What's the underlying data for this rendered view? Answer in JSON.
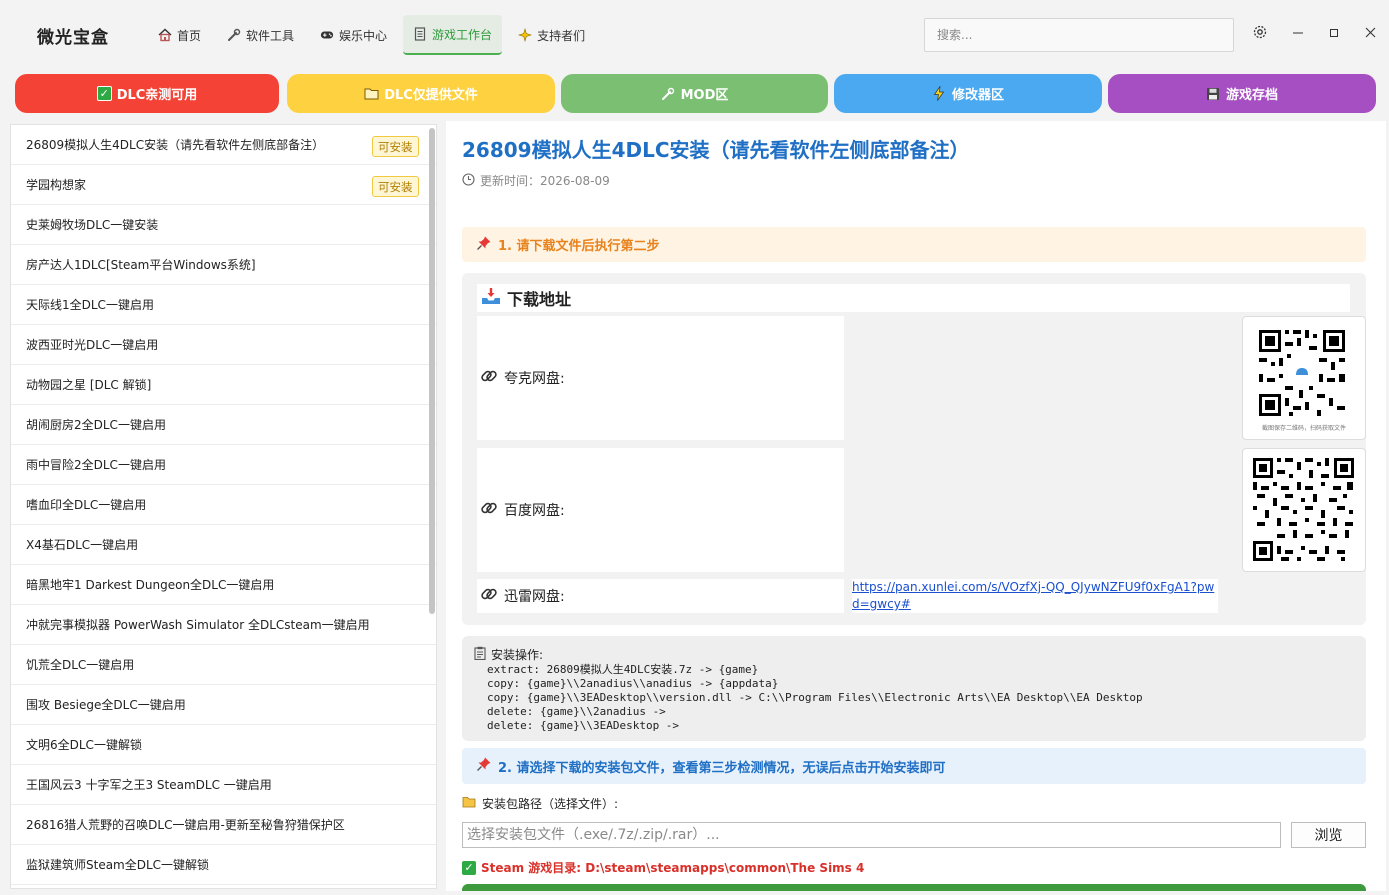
{
  "app": {
    "title": "微光宝盒"
  },
  "nav": [
    {
      "label": "首页",
      "icon": "home-icon"
    },
    {
      "label": "软件工具",
      "icon": "wrench-icon"
    },
    {
      "label": "娱乐中心",
      "icon": "gamepad-icon"
    },
    {
      "label": "游戏工作台",
      "icon": "document-icon",
      "active": true
    },
    {
      "label": "支持者们",
      "icon": "sparkle-icon"
    }
  ],
  "search": {
    "placeholder": "搜索..."
  },
  "window_controls": {
    "settings": "gear-icon",
    "minimize": "minimize-icon",
    "maximize": "maximize-icon",
    "close": "close-icon"
  },
  "categories": [
    {
      "label": "DLC亲测可用",
      "color": "#f44336",
      "icon": "check-box-icon"
    },
    {
      "label": "DLC仅提供文件",
      "color": "#fdd13f",
      "icon": "folder-icon"
    },
    {
      "label": "MOD区",
      "color": "#7bbf72",
      "icon": "wrench-icon"
    },
    {
      "label": "修改器区",
      "color": "#4aa9f0",
      "icon": "lightning-icon"
    },
    {
      "label": "游戏存档",
      "color": "#a64fc2",
      "icon": "floppy-icon"
    }
  ],
  "list": [
    {
      "name": "26809模拟人生4DLC安装（请先看软件左侧底部备注）",
      "badge": "可安装"
    },
    {
      "name": "学园构想家",
      "badge": "可安装"
    },
    {
      "name": "史莱姆牧场DLC一键安装"
    },
    {
      "name": "房产达人1DLC[Steam平台Windows系统]"
    },
    {
      "name": "天际线1全DLC一键启用"
    },
    {
      "name": "波西亚时光DLC一键启用"
    },
    {
      "name": "动物园之星 [DLC 解锁]"
    },
    {
      "name": "胡闹厨房2全DLC一键启用"
    },
    {
      "name": "雨中冒险2全DLC一键启用"
    },
    {
      "name": "嗜血印全DLC一键启用"
    },
    {
      "name": "X4基石DLC一键启用"
    },
    {
      "name": "暗黑地牢1 Darkest Dungeon全DLC一键启用"
    },
    {
      "name": "冲就完事模拟器 PowerWash Simulator 全DLCsteam一键启用"
    },
    {
      "name": "饥荒全DLC一键启用"
    },
    {
      "name": "围攻 Besiege全DLC一键启用"
    },
    {
      "name": "文明6全DLC一键解锁"
    },
    {
      "name": "王国风云3 十字军之王3 SteamDLC 一键启用"
    },
    {
      "name": "26816猎人荒野的召唤DLC一键启用-更新至秘鲁狩猎保护区"
    },
    {
      "name": "监狱建筑师Steam全DLC一键解锁"
    }
  ],
  "detail": {
    "title": "26809模拟人生4DLC安装（请先看软件左侧底部备注）",
    "update_label": "更新时间：",
    "update_date": "2026-08-09",
    "step1": "1. 请下载文件后执行第二步",
    "download_title": "下载地址",
    "quark_label": "夸克网盘:",
    "baidu_label": "百度网盘:",
    "xunlei_label": "迅雷网盘:",
    "xunlei_url": "https://pan.xunlei.com/s/VOzfXj-QQ_QJywNZFU9f0xFgA1?pwd=gwcy#",
    "quark_qr_caption": "截图保存二维码，扫码获取文件",
    "install_title": "安装操作:",
    "install_lines": [
      "extract: 26809模拟人生4DLC安装.7z -> {game}",
      "copy: {game}\\\\2anadius\\\\anadius -> {appdata}",
      "copy: {game}\\\\3EADesktop\\\\version.dll -> C:\\\\Program Files\\\\Electronic Arts\\\\EA Desktop\\\\EA Desktop",
      "delete: {game}\\\\2anadius ->",
      "delete: {game}\\\\3EADesktop ->"
    ],
    "step2": "2. 请选择下载的安装包文件，查看第三步检测情况，无误后点击开始安装即可",
    "path_label": "安装包路径（选择文件）:",
    "path_placeholder": "选择安装包文件（.exe/.7z/.zip/.rar）...",
    "browse_label": "浏览",
    "steam_dir": "Steam 游戏目录: D:\\steam\\steamapps\\common\\The Sims 4"
  }
}
